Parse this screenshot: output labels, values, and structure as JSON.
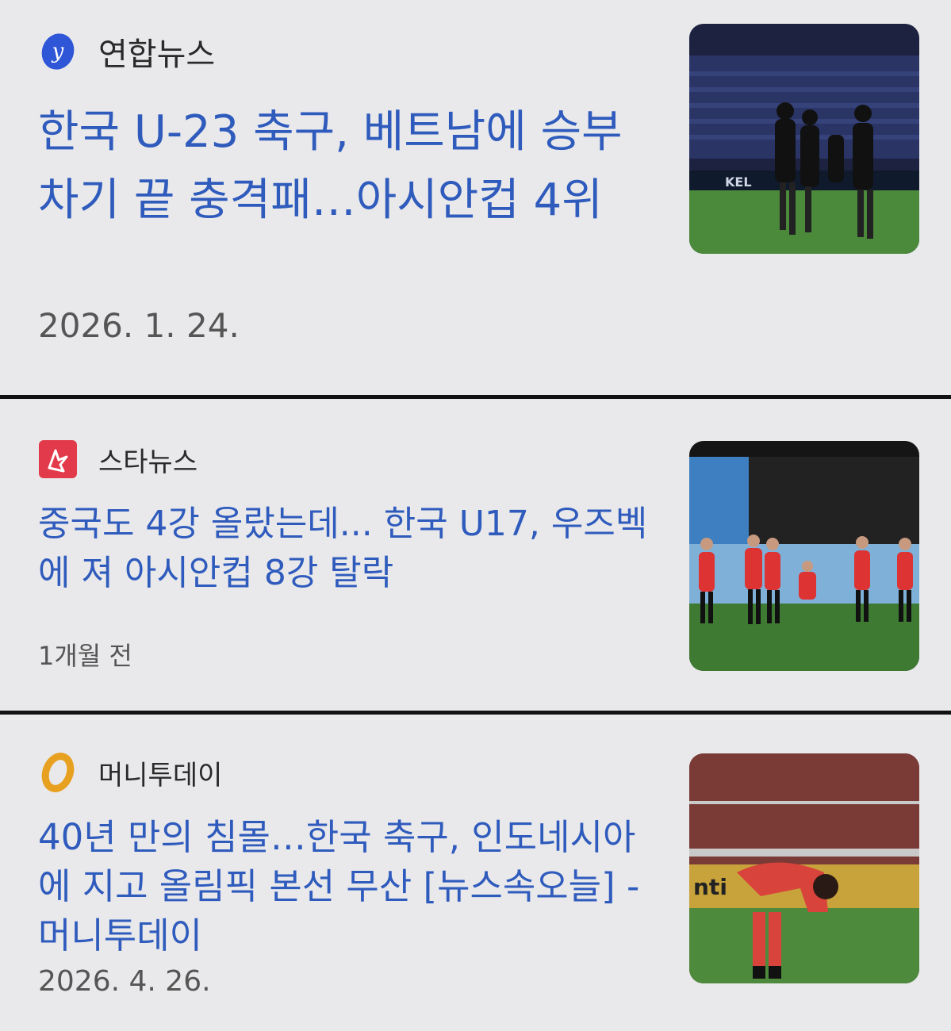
{
  "articles": [
    {
      "source": "연합뉴스",
      "source_logo_icon": "yonhap-logo-icon",
      "headline": "한국 U-23 축구, 베트남에 승부차기 끝 충격패…아시안컵 4위",
      "date": "2026. 1. 24.",
      "thumbnail": "players-night-stadium-photo"
    },
    {
      "source": "스타뉴스",
      "source_logo_icon": "starnews-logo-icon",
      "headline": "중국도 4강 올랐는데... 한국 U17, 우즈벡에 져 아시안컵 8강 탈락",
      "date": "1개월 전",
      "thumbnail": "red-kit-players-photo"
    },
    {
      "source": "머니투데이",
      "source_logo_icon": "moneytoday-logo-icon",
      "headline": "40년 만의 침몰…한국 축구, 인도네시아에 지고 올림픽 본선 무산 [뉴스속오늘] - 머니투데이",
      "date": "2026. 4. 26.",
      "thumbnail": "dejected-player-photo"
    }
  ],
  "colors": {
    "background": "#e9e9eb",
    "headline": "#2f5bbd",
    "divider": "#111111",
    "yonhap_logo": "#2f56d6",
    "starnews_logo": "#e23a4a",
    "moneytoday_logo": "#e8a020"
  }
}
